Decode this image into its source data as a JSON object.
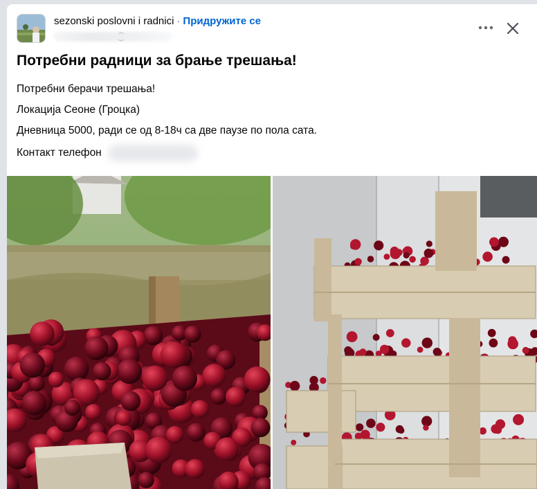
{
  "post": {
    "group_name": "sezonski poslovni i radnici",
    "separator": "·",
    "join_label": "Придружите се",
    "title": "Потребни радници за брање трешања!",
    "lines": [
      "Потребни берачи трешања!",
      "Локација Сеоне (Гроцка)",
      "Дневница 5000, ради се од 8-18ч са две паузе по пола сата.",
      "Контакт телефон"
    ]
  },
  "icons": {
    "privacy": "globe-icon",
    "more": "more-options-icon",
    "close": "close-icon"
  },
  "colors": {
    "join_link": "#0064d1",
    "text": "#050505",
    "secondary": "#65676b",
    "background": "#dfe3e8",
    "card": "#ffffff"
  },
  "images": [
    {
      "name": "cherries-crate-garden-photo"
    },
    {
      "name": "stacked-cherry-crates-photo"
    }
  ]
}
